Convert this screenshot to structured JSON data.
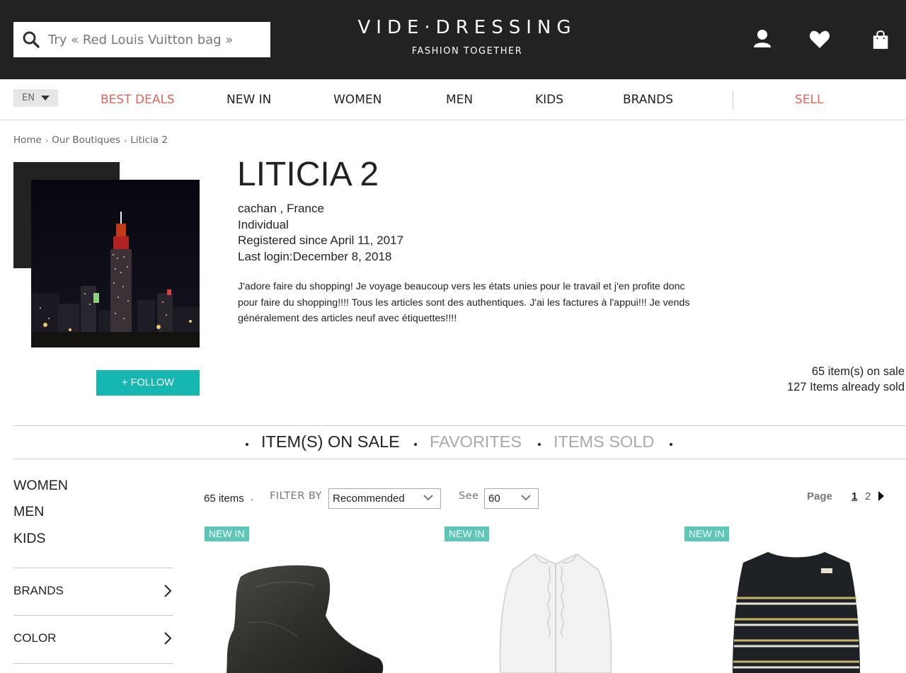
{
  "header": {
    "search_placeholder": "Try « Red Louis Vuitton bag »",
    "logo_title": "VIDE·DRESSING",
    "logo_tagline": "FASHION TOGETHER",
    "icons": [
      "user-icon",
      "heart-icon",
      "shopping-bag-icon"
    ]
  },
  "nav": {
    "lang": "EN",
    "items": [
      "BEST DEALS",
      "NEW IN",
      "WOMEN",
      "MEN",
      "KIDS",
      "BRANDS"
    ],
    "sell": "SELL",
    "accent_color": "#e0665c"
  },
  "breadcrumb": [
    "Home",
    "Our Boutiques",
    "Liticia 2"
  ],
  "boutique": {
    "name": "LITICIA 2",
    "location": "cachan , France",
    "type": "Individual",
    "registered": "Registered since April 11, 2017",
    "last_login": "Last login:December 8, 2018",
    "description": "J'adore faire du shopping! Je voyage beaucoup vers les états unies pour le travail et j'en profite donc pour faire du shopping!!!! Tous les articles sont des authentiques. J'ai les factures à l'appui!!! Je vends généralement des articles neuf avec étiquettes!!!!",
    "follow_label": "+ FOLLOW",
    "follow_color": "#17b7b1",
    "items_on_sale": "65 item(s) on sale",
    "items_sold": "127 Items already sold"
  },
  "tabs": [
    {
      "label": "ITEM(S) ON SALE",
      "active": true
    },
    {
      "label": "FAVORITES",
      "active": false
    },
    {
      "label": "ITEMS SOLD",
      "active": false
    }
  ],
  "sidebar": {
    "categories": [
      "WOMEN",
      "MEN",
      "KIDS"
    ],
    "filters": [
      "BRANDS",
      "COLOR"
    ]
  },
  "toolbar": {
    "count": "65 items",
    "filter_label": "FILTER BY",
    "filter_value": "Recommended",
    "see_label": "See",
    "see_value": "60",
    "page_label": "Page",
    "pages": [
      "1",
      "2"
    ],
    "current_page": "1"
  },
  "products": [
    {
      "badge": "NEW IN",
      "kind": "ankle boot"
    },
    {
      "badge": "NEW IN",
      "kind": "white ruffle blouse"
    },
    {
      "badge": "NEW IN",
      "kind": "striped sweater"
    }
  ]
}
